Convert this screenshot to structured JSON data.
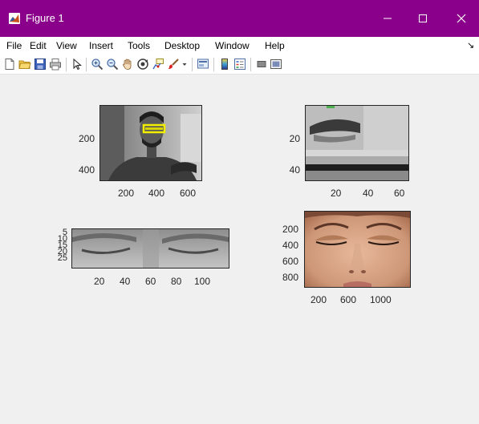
{
  "window": {
    "title": "Figure 1",
    "title_bar_color": "#8b008b",
    "controls": {
      "minimize_icon": "minimize-icon",
      "maximize_icon": "maximize-icon",
      "close_icon": "close-icon"
    }
  },
  "menu": {
    "items": [
      "File",
      "Edit",
      "View",
      "Insert",
      "Tools",
      "Desktop",
      "Window",
      "Help"
    ]
  },
  "toolbar": {
    "buttons": [
      "new-figure-icon",
      "open-file-icon",
      "save-icon",
      "print-icon",
      "pointer-icon",
      "zoom-in-icon",
      "zoom-out-icon",
      "pan-icon",
      "rotate-3d-icon",
      "data-cursor-icon",
      "brush-icon",
      "link-plot-icon",
      "colorbar-icon",
      "legend-icon",
      "hide-plot-tools-icon",
      "show-plot-tools-icon"
    ]
  },
  "subplots": [
    {
      "name": "face-with-eye-box",
      "x_ticks": [
        "200",
        "400",
        "600"
      ],
      "y_ticks": [
        "200",
        "400"
      ]
    },
    {
      "name": "eye-crop-zoom",
      "x_ticks": [
        "20",
        "40",
        "60"
      ],
      "y_ticks": [
        "20",
        "40"
      ]
    },
    {
      "name": "eyes-strip",
      "x_ticks": [
        "20",
        "40",
        "60",
        "80",
        "100"
      ],
      "y_ticks": [
        "5",
        "10",
        "15",
        "20",
        "25"
      ]
    },
    {
      "name": "closed-eyes-face",
      "x_ticks": [
        "200",
        "600",
        "1000"
      ],
      "y_ticks": [
        "200",
        "400",
        "600",
        "800"
      ]
    }
  ]
}
